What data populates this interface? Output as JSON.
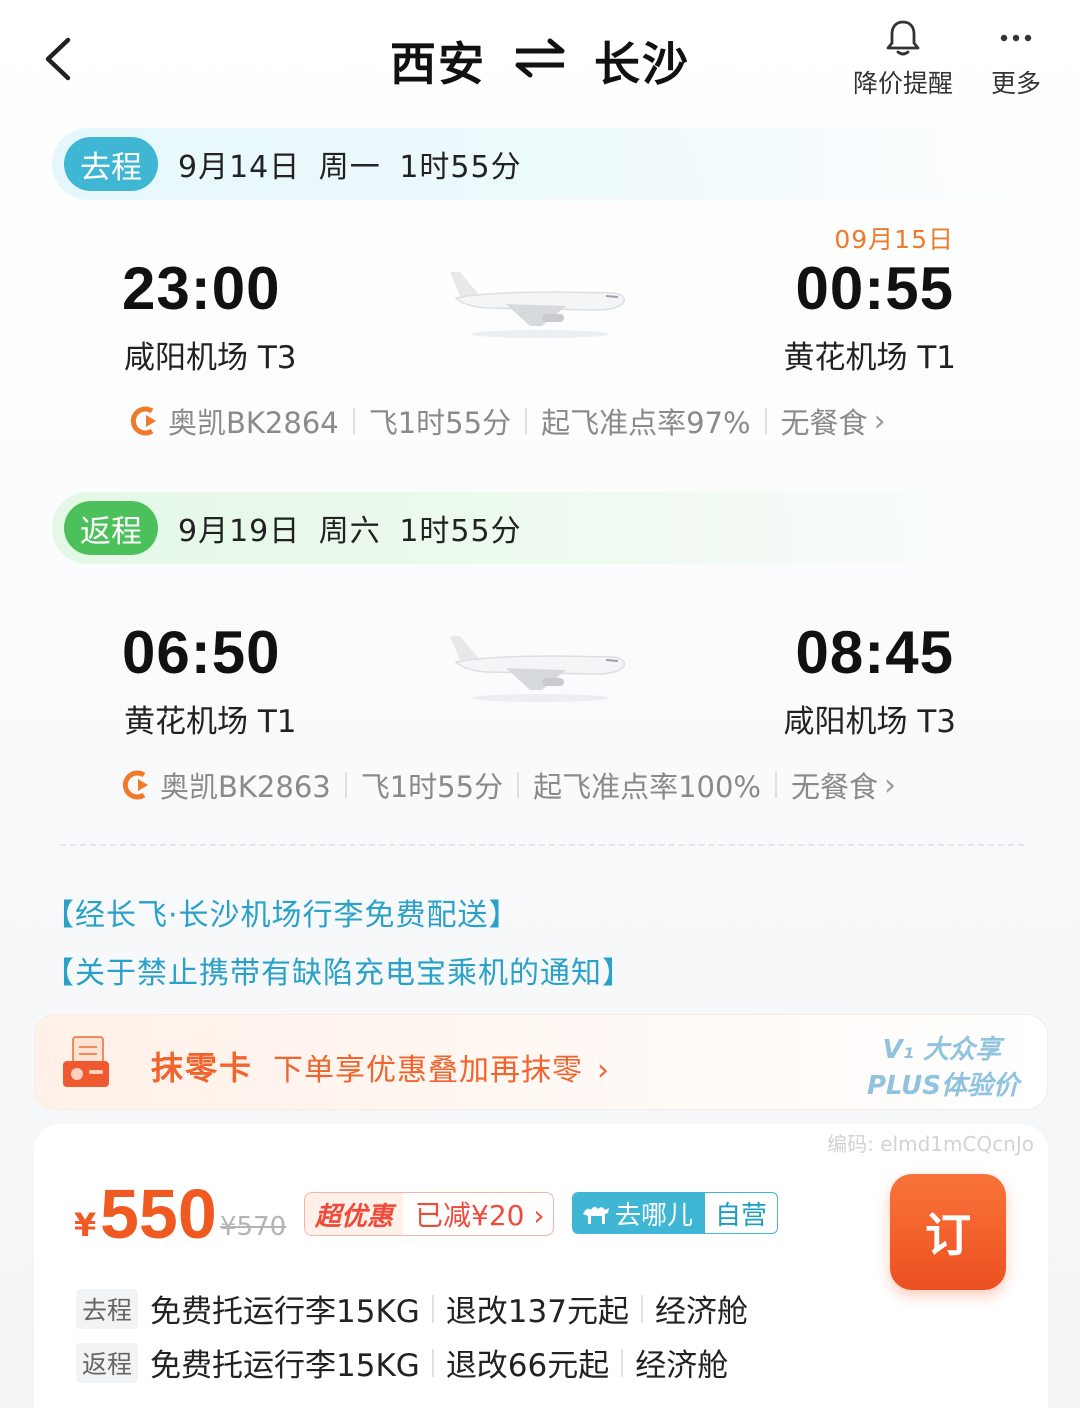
{
  "header": {
    "from_city": "西安",
    "to_city": "长沙",
    "price_alert_label": "降价提醒",
    "more_label": "更多"
  },
  "outbound": {
    "tag": "去程",
    "date_info": "9月14日 周一  1时55分",
    "next_day": "09月15日",
    "dep_time": "23:00",
    "arr_time": "00:55",
    "dep_airport": "咸阳机场 T3",
    "arr_airport": "黄花机场 T1",
    "airline_flight": "奥凯BK2864",
    "duration": "飞1时55分",
    "on_time": "起飞准点率97%",
    "meal": "无餐食"
  },
  "return": {
    "tag": "返程",
    "date_info": "9月19日 周六  1时55分",
    "dep_time": "06:50",
    "arr_time": "08:45",
    "dep_airport": "黄花机场 T1",
    "arr_airport": "咸阳机场 T3",
    "airline_flight": "奥凯BK2863",
    "duration": "飞1时55分",
    "on_time": "起飞准点率100%",
    "meal": "无餐食"
  },
  "notices": [
    "【经长飞·长沙机场行李免费配送】",
    "【关于禁止携带有缺陷充电宝乘机的通知】"
  ],
  "promo": {
    "title": "抹零卡",
    "desc": "下单享优惠叠加再抹零",
    "vip_line1": "V₁ 大众享",
    "vip_line2": "PLUS体验价"
  },
  "price_card": {
    "watermark": "编码: elmd1mCQcnJo",
    "currency": "¥",
    "price": "550",
    "original_price": "¥570",
    "deal_label": "超优惠",
    "deal_value": "已减¥20",
    "vendor_name": "去哪儿",
    "vendor_tag": "自营",
    "book_label": "订",
    "rows": [
      {
        "tag": "去程",
        "baggage": "免费托运行李15KG",
        "refund": "退改137元起",
        "cabin": "经济舱"
      },
      {
        "tag": "返程",
        "baggage": "免费托运行李15KG",
        "refund": "退改66元起",
        "cabin": "经济舱"
      }
    ]
  },
  "colors": {
    "accent_orange": "#ee5a22",
    "outbound_tag": "#3fb6d3",
    "return_tag": "#4cc05a",
    "link_blue": "#2aa1c8"
  }
}
